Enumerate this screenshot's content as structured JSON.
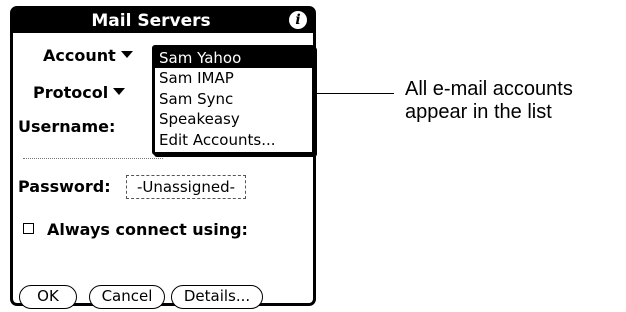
{
  "window": {
    "title": "Mail Servers",
    "info_glyph": "i"
  },
  "form": {
    "account_label": "Account",
    "protocol_label": "Protocol",
    "username_label": "Username:",
    "password_label": "Password:",
    "password_value": "-Unassigned-",
    "always_connect_label": "Always connect using:",
    "always_connect_checked": false
  },
  "account_list": {
    "items": [
      "Sam Yahoo",
      "Sam IMAP",
      "Sam Sync",
      "Speakeasy",
      "Edit Accounts..."
    ],
    "selected": "Sam Yahoo"
  },
  "buttons": {
    "ok": "OK",
    "cancel": "Cancel",
    "details": "Details..."
  },
  "callout": {
    "line1": "All e-mail accounts",
    "line2": "appear in the list"
  },
  "icons": {
    "info": "info-icon",
    "account_dropdown": "triangle-down-icon",
    "protocol_dropdown": "triangle-down-icon"
  }
}
